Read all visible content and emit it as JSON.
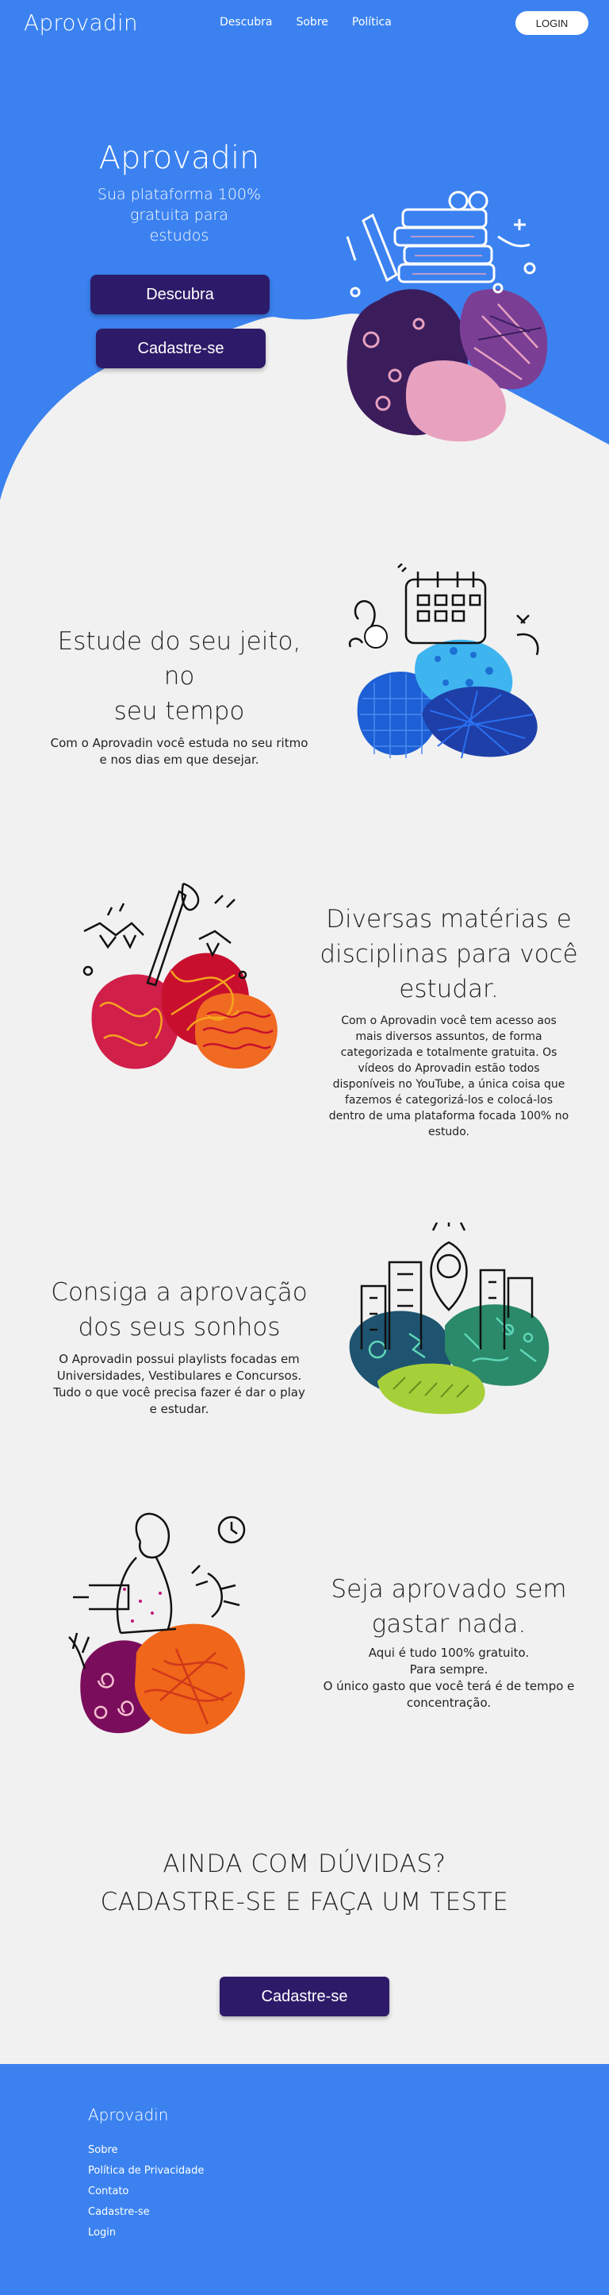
{
  "nav": {
    "brand": "Aprovadin",
    "links": [
      "Descubra",
      "Sobre",
      "Política"
    ],
    "login": "LOGIN"
  },
  "hero": {
    "title": "Aprovadin",
    "subtitle_lines": [
      "Sua plataforma 100%",
      "gratuita para",
      "estudos"
    ],
    "btn_descubra": "Descubra",
    "btn_cadastre": "Cadastre-se"
  },
  "sections": [
    {
      "title_lines": [
        "Estude do seu jeito, no",
        "seu tempo"
      ],
      "text_lines": [
        "Com o Aprovadin você estuda no seu ritmo",
        "e nos dias em que desejar."
      ]
    },
    {
      "title_lines": [
        "Diversas matérias e",
        "disciplinas para você",
        "estudar."
      ],
      "text_lines": [
        "Com o Aprovadin você tem acesso aos",
        "mais diversos assuntos, de forma",
        "categorizada e totalmente gratuita. Os",
        "vídeos do Aprovadin estão todos",
        "disponíveis no YouTube, a única coisa que",
        "fazemos é categorizá-los e colocá-los",
        "dentro de uma plataforma focada 100% no",
        "estudo."
      ]
    },
    {
      "title_lines": [
        "Consiga a aprovação",
        "dos seus sonhos"
      ],
      "text_lines": [
        "O Aprovadin possui playlists focadas em",
        "Universidades, Vestibulares e Concursos.",
        "Tudo o que você precisa fazer é dar o play",
        "e estudar."
      ]
    },
    {
      "title_lines": [
        "Seja aprovado sem",
        "gastar nada."
      ],
      "text_lines": [
        "Aqui é tudo 100% gratuito.",
        "Para sempre.",
        "O único gasto que você terá é de tempo e",
        "concentração."
      ]
    }
  ],
  "cta": {
    "line1": "AINDA COM DÚVIDAS?",
    "line2": "CADASTRE-SE E FAÇA UM TESTE",
    "button": "Cadastre-se"
  },
  "footer": {
    "brand": "Aprovadin",
    "links": [
      "Sobre",
      "Política de Privacidade",
      "Contato",
      "Cadastre-se",
      "Login"
    ]
  },
  "colors": {
    "primary_blue": "#3b82f0",
    "button_purple": "#2d1b69",
    "background": "#f2f1f1"
  }
}
